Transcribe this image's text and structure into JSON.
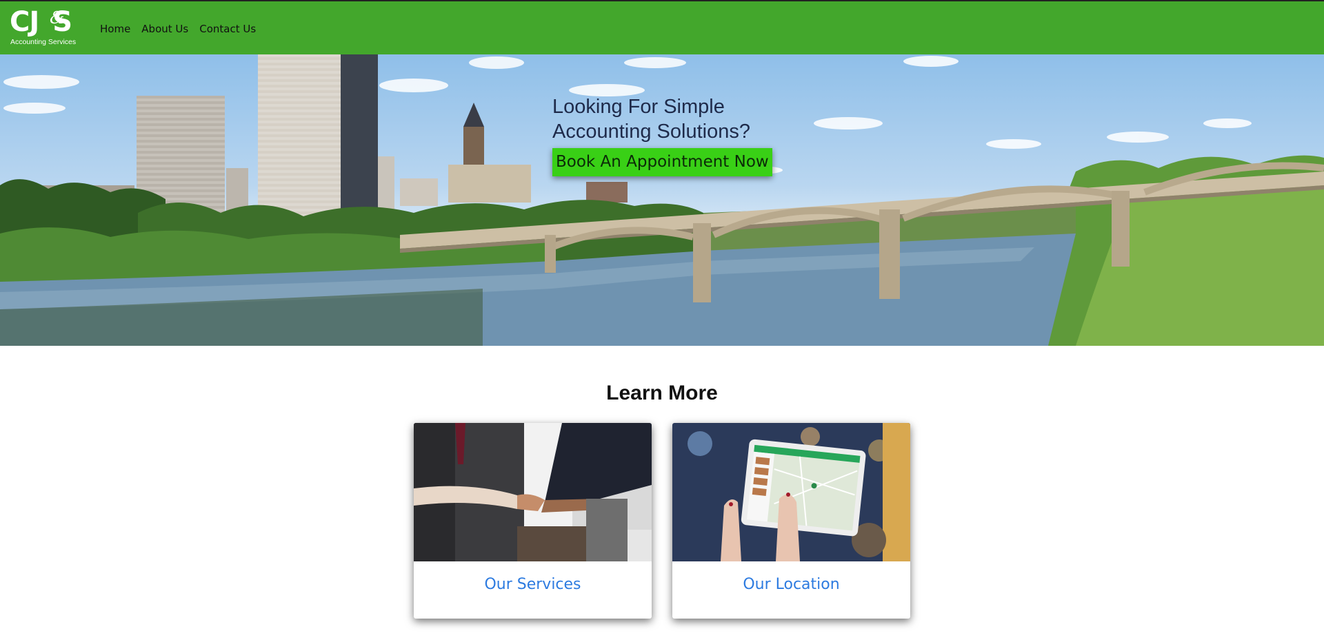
{
  "brand": {
    "logo_letters": "CJ",
    "logo_amp": "&",
    "logo_letter_s": "S",
    "logo_sub": "Accounting Services",
    "color_primary": "#43a72c",
    "color_cta": "#39d016",
    "color_link": "#2d7be0"
  },
  "nav": {
    "items": [
      {
        "label": "Home"
      },
      {
        "label": "About Us"
      },
      {
        "label": "Contact Us"
      }
    ]
  },
  "hero": {
    "heading_line1": "Looking For Simple",
    "heading_line2": "Accounting Solutions?",
    "cta_label": "Book An Appointment Now"
  },
  "learn_more": {
    "heading": "Learn More",
    "cards": [
      {
        "title": "Our Services",
        "image": "handshake-photo"
      },
      {
        "title": "Our Location",
        "image": "tablet-map-photo"
      }
    ]
  }
}
